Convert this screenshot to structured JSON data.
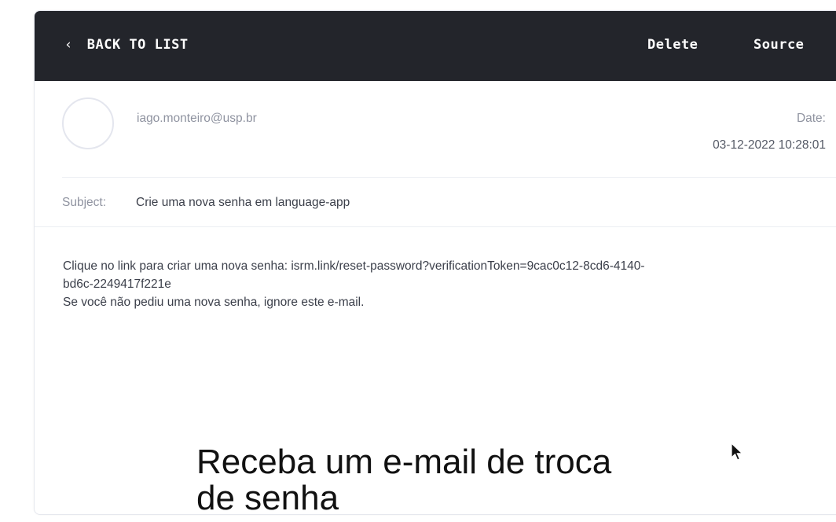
{
  "header": {
    "back_chevron": "‹",
    "back_label": "BACK TO LIST",
    "delete_label": "Delete",
    "source_label": "Source"
  },
  "message": {
    "sender": "iago.monteiro@usp.br",
    "date_label": "Date:",
    "date_value": "03-12-2022 10:28:01",
    "subject_label": "Subject:",
    "subject_value": "Crie uma nova senha em language-app",
    "body_lines": [
      "Clique no link para criar uma nova senha: isrm.link/reset-password?verificationToken=9cac0c12-8cd6-4140-",
      "bd6c-2249417f221e",
      "Se você não pediu uma nova senha, ignore este e-mail."
    ]
  },
  "overlay": {
    "caption_line1": "Receba um e-mail de troca",
    "caption_line2": "de senha"
  },
  "colors": {
    "topbar": "#23252b",
    "muted_text": "#8f93a0",
    "body_text": "#3b3f4a"
  },
  "icons": {
    "avatar": "avatar-circle",
    "cursor": "mouse-pointer-icon"
  }
}
